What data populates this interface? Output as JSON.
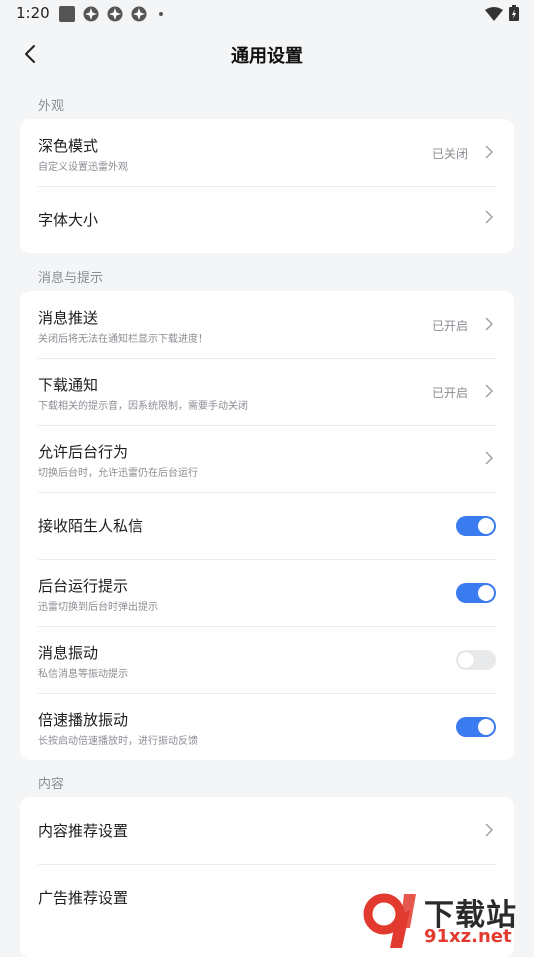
{
  "status_bar": {
    "time": "1:20"
  },
  "header": {
    "title": "通用设置",
    "back_icon": "chevron-left-icon"
  },
  "sections": [
    {
      "label": "外观",
      "rows": [
        {
          "title": "深色模式",
          "subtitle": "自定义设置迅雷外观",
          "value": "已关闭",
          "control": "chevron"
        },
        {
          "title": "字体大小",
          "control": "chevron"
        }
      ]
    },
    {
      "label": "消息与提示",
      "rows": [
        {
          "title": "消息推送",
          "subtitle": "关闭后将无法在通知栏显示下载进度！",
          "value": "已开启",
          "control": "chevron"
        },
        {
          "title": "下载通知",
          "subtitle": "下载相关的提示音，因系统限制，需要手动关闭",
          "value": "已开启",
          "control": "chevron"
        },
        {
          "title": "允许后台行为",
          "subtitle": "切换后台时，允许迅雷仍在后台运行",
          "control": "chevron"
        },
        {
          "title": "接收陌生人私信",
          "control": "toggle",
          "on": true
        },
        {
          "title": "后台运行提示",
          "subtitle": "迅雷切换到后台时弹出提示",
          "control": "toggle",
          "on": true
        },
        {
          "title": "消息振动",
          "subtitle": "私信消息等振动提示",
          "control": "toggle",
          "on": false
        },
        {
          "title": "倍速播放振动",
          "subtitle": "长按启动倍速播放时，进行振动反馈",
          "control": "toggle",
          "on": true
        }
      ]
    },
    {
      "label": "内容",
      "rows": [
        {
          "title": "内容推荐设置",
          "control": "chevron"
        },
        {
          "title": "广告推荐设置",
          "control": "chevron"
        }
      ]
    }
  ],
  "watermark": {
    "text_top": "下载站",
    "text_bottom": "91xz.net"
  },
  "colors": {
    "accent": "#3a7bf0",
    "background": "#f4f5f7",
    "card": "#ffffff",
    "secondary_text": "#8a8d93",
    "toggle_off": "#e8e9eb",
    "watermark_red": "#e23a2e"
  }
}
